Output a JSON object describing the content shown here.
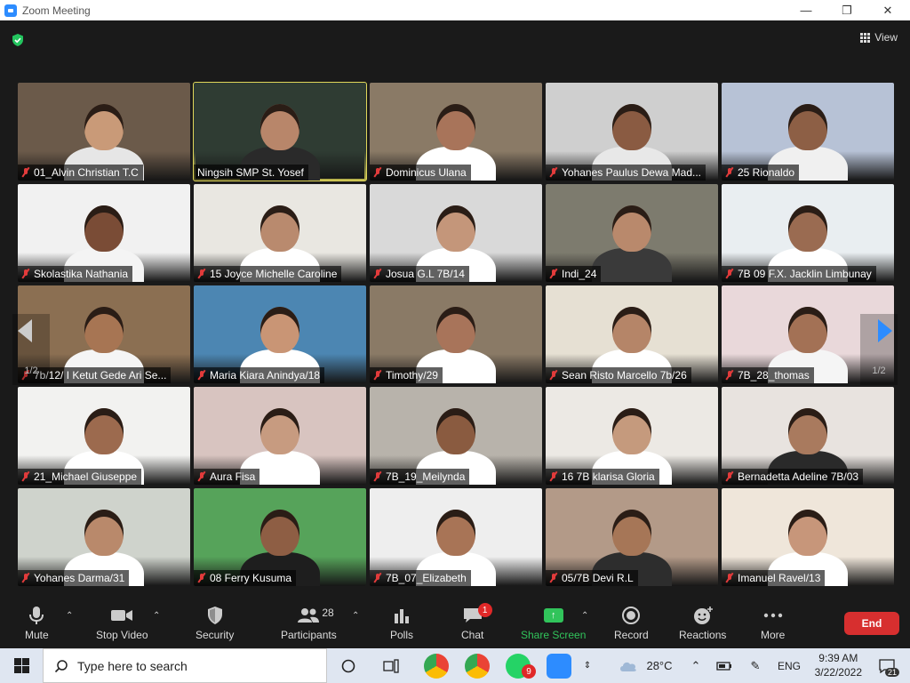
{
  "window": {
    "title": "Zoom Meeting",
    "minimize_icon": "—",
    "restore_icon": "❐",
    "close_icon": "✕"
  },
  "top": {
    "view_label": "View"
  },
  "page_indicator": {
    "left": "1/2",
    "right": "1/2"
  },
  "participants": [
    {
      "name": "01_Alvin Christian T.C",
      "muted": true,
      "bg": "#6b5a4a",
      "skin": "#c99a78",
      "shirt": "#e6e6e6"
    },
    {
      "name": "Ningsih SMP St. Yosef",
      "muted": false,
      "active": true,
      "bg": "#2f3c33",
      "skin": "#b8866a",
      "shirt": "#2a2a2a"
    },
    {
      "name": "Dominicus Ulana",
      "muted": true,
      "bg": "#8a7a66",
      "skin": "#a8745a",
      "shirt": "#ffffff"
    },
    {
      "name": "Yohanes Paulus Dewa Mad...",
      "muted": true,
      "bg": "#cfcfcf",
      "skin": "#8a5b42",
      "shirt": "#e8e8e8"
    },
    {
      "name": "25 Rionaldo",
      "muted": true,
      "bg": "#b7c2d6",
      "skin": "#8d5f45",
      "shirt": "#f0f0f0"
    },
    {
      "name": "Skolastika Nathania",
      "muted": true,
      "bg": "#f1f1f1",
      "skin": "#7a4c36",
      "shirt": "#f4f4f4"
    },
    {
      "name": "15 Joyce Michelle Caroline",
      "muted": true,
      "bg": "#e9e7e1",
      "skin": "#b98a6e",
      "shirt": "#ffffff"
    },
    {
      "name": "Josua G.L 7B/14",
      "muted": true,
      "bg": "#d9d9d9",
      "skin": "#c4967a",
      "shirt": "#ffffff"
    },
    {
      "name": "Indi_24",
      "muted": true,
      "bg": "#7d7b6e",
      "skin": "#b9896c",
      "shirt": "#3a3a3a"
    },
    {
      "name": "7B 09 F.X. Jacklin Limbunay",
      "muted": true,
      "bg": "#e9eef1",
      "skin": "#9a6b51",
      "shirt": "#ffffff"
    },
    {
      "name": "7b/12/ I Ketut Gede Ari Se...",
      "muted": true,
      "bg": "#8b6f52",
      "skin": "#a77553",
      "shirt": "#f5f5f5"
    },
    {
      "name": "Maria Kiara Anindya/18",
      "muted": true,
      "bg": "#4c86b2",
      "skin": "#c99575",
      "shirt": "#ffffff"
    },
    {
      "name": "Timothy/29",
      "muted": true,
      "bg": "#8a7a66",
      "skin": "#a8745a",
      "shirt": "#ffffff"
    },
    {
      "name": "Sean Risto Marcello 7b/26",
      "muted": true,
      "bg": "#e6e0d3",
      "skin": "#b58568",
      "shirt": "#ffffff"
    },
    {
      "name": "7B_28_thomas",
      "muted": true,
      "bg": "#e9d8da",
      "skin": "#a37155",
      "shirt": "#f5f5f5"
    },
    {
      "name": "21_Michael Giuseppe",
      "muted": true,
      "bg": "#f2f2f0",
      "skin": "#9c6a4e",
      "shirt": "#ffffff"
    },
    {
      "name": "Aura Fisa",
      "muted": true,
      "bg": "#d8c4c0",
      "skin": "#c79b80",
      "shirt": "#ffffff"
    },
    {
      "name": "7B_19_Meilynda",
      "muted": true,
      "bg": "#b8b3ab",
      "skin": "#8a5b40",
      "shirt": "#ffffff"
    },
    {
      "name": "16 7B klarisa Gloria",
      "muted": true,
      "bg": "#ece9e4",
      "skin": "#c59a7d",
      "shirt": "#ffffff"
    },
    {
      "name": "Bernadetta Adeline 7B/03",
      "muted": true,
      "bg": "#e8e3df",
      "skin": "#a97a5e",
      "shirt": "#2a2a2a"
    },
    {
      "name": "Yohanes Darma/31",
      "muted": true,
      "bg": "#cfd3cc",
      "skin": "#b9896b",
      "shirt": "#ffffff"
    },
    {
      "name": "08 Ferry Kusuma",
      "muted": true,
      "bg": "#56a35a",
      "skin": "#8e5e44",
      "shirt": "#1e1e1e"
    },
    {
      "name": "7B_07_Elizabeth",
      "muted": true,
      "bg": "#eeeeee",
      "skin": "#a87456",
      "shirt": "#ffffff"
    },
    {
      "name": "05/7B Devi R.L",
      "muted": true,
      "bg": "#b39a88",
      "skin": "#a67657",
      "shirt": "#2d2d2d"
    },
    {
      "name": "Imanuel Ravel/13",
      "muted": true,
      "bg": "#efe6da",
      "skin": "#c7967a",
      "shirt": "#ffffff"
    }
  ],
  "toolbar": {
    "mute": "Mute",
    "stop_video": "Stop Video",
    "security": "Security",
    "participants": "Participants",
    "participants_count": "28",
    "polls": "Polls",
    "chat": "Chat",
    "chat_badge": "1",
    "share_screen": "Share Screen",
    "record": "Record",
    "reactions": "Reactions",
    "more": "More",
    "end": "End"
  },
  "taskbar": {
    "search_placeholder": "Type here to search",
    "weather": "28°C",
    "lang": "ENG",
    "time": "9:39 AM",
    "date": "3/22/2022",
    "whatsapp_badge": "9",
    "notif_count": "21"
  },
  "colors": {
    "accent_blue": "#2d8cff",
    "share_green": "#31c45b",
    "end_red": "#d72f2f",
    "active_speaker": "#e0d75a"
  }
}
